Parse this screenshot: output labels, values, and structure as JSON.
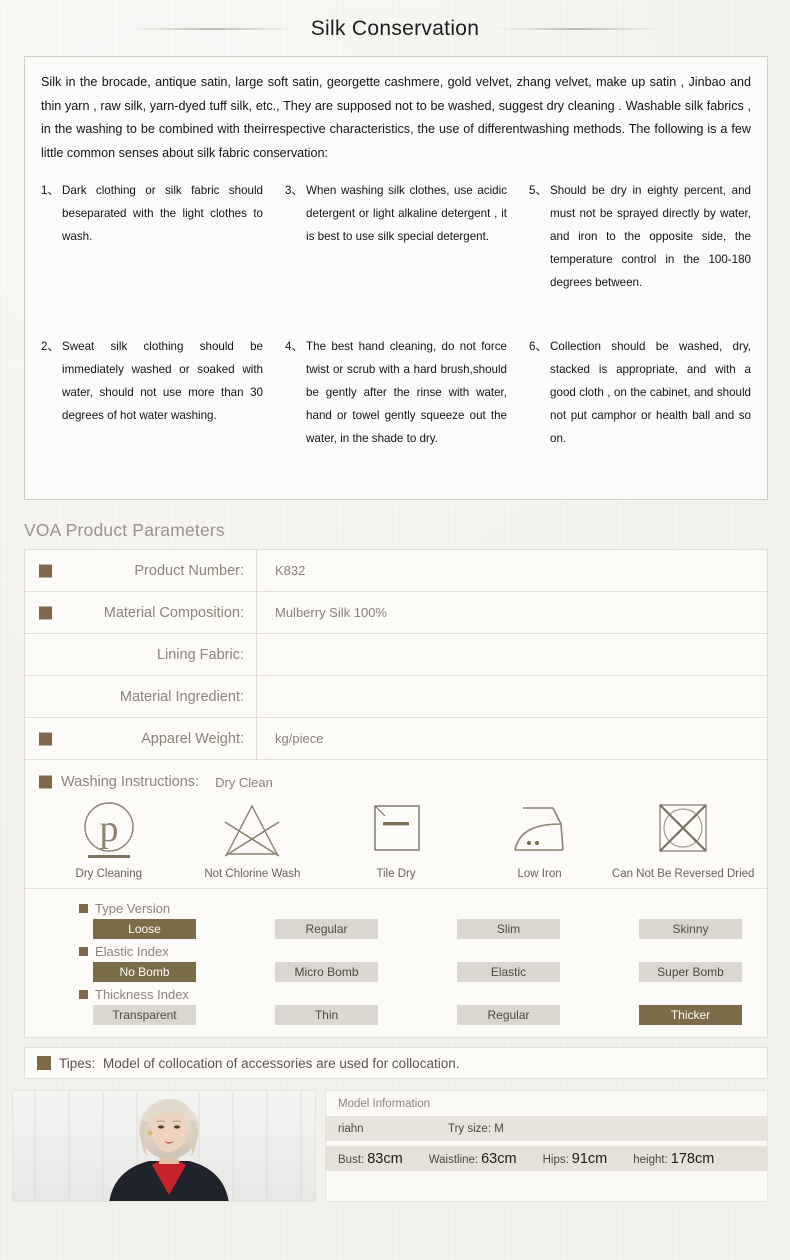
{
  "header": {
    "title": "Silk Conservation"
  },
  "conservation": {
    "intro": "Silk in the brocade, antique satin, large soft satin, georgette cashmere, gold velvet, zhang velvet, make up satin , Jinbao and thin yarn , raw silk, yarn-dyed tuff silk, etc., They are supposed not to be washed, suggest dry cleaning . Washable silk fabrics , in the washing to be combined with theirrespective characteristics, the use of differentwashing methods. The following is a few little common senses about silk fabric conservation:",
    "notes": [
      {
        "num": "1、",
        "text": "Dark clothing or silk fabric should beseparated with the light clothes to wash."
      },
      {
        "num": "3、",
        "text": "When washing silk clothes, use acidic detergent or light alkaline detergent , it is best to use silk special detergent."
      },
      {
        "num": "5、",
        "text": "Should be dry in eighty percent, and must not be sprayed directly by water, and iron to the opposite side, the temperature control in the 100-180 degrees between."
      },
      {
        "num": "2、",
        "text": "Sweat silk clothing should be immediately washed or soaked with water, should not use more than 30 degrees of hot water washing."
      },
      {
        "num": "4、",
        "text": "The best hand cleaning, do not force twist or scrub with a hard brush,should be gently after the rinse with water, hand or towel gently squeeze out the water, in the shade to dry."
      },
      {
        "num": "6、",
        "text": "Collection should be washed, dry, stacked is appropriate, and with a good cloth , on the cabinet, and should not put camphor or health ball and so on."
      }
    ]
  },
  "parameters": {
    "heading": "VOA Product Parameters",
    "rows": [
      {
        "label": "Product Number:",
        "value": "K832",
        "marker": true
      },
      {
        "label": "Material Composition:",
        "value": "Mulberry Silk 100%",
        "marker": true
      },
      {
        "label": "Lining Fabric:",
        "value": "",
        "marker": false
      },
      {
        "label": "Material Ingredient:",
        "value": "",
        "marker": false
      },
      {
        "label": "Apparel Weight:",
        "value": "kg/piece",
        "marker": true
      }
    ]
  },
  "washing": {
    "label": "Washing Instructions:",
    "value": "Dry Clean",
    "icons": [
      {
        "name": "dry-cleaning-icon",
        "label": "Dry Cleaning"
      },
      {
        "name": "not-chlorine-wash-icon",
        "label": "Not Chlorine Wash"
      },
      {
        "name": "tile-dry-icon",
        "label": "Tile Dry"
      },
      {
        "name": "low-iron-icon",
        "label": "Low Iron"
      },
      {
        "name": "no-tumble-dry-icon",
        "label": "Can Not Be Reversed Dried"
      }
    ]
  },
  "indexes": [
    {
      "label": "Type Version",
      "tags": [
        {
          "text": "Loose",
          "selected": true
        },
        {
          "text": "Regular",
          "selected": false
        },
        {
          "text": "Slim",
          "selected": false
        },
        {
          "text": "Skinny",
          "selected": false
        }
      ]
    },
    {
      "label": "Elastic Index",
      "tags": [
        {
          "text": "No  Bomb",
          "selected": true
        },
        {
          "text": "Micro  Bomb",
          "selected": false
        },
        {
          "text": "Elastic",
          "selected": false
        },
        {
          "text": "Super  Bomb",
          "selected": false
        }
      ]
    },
    {
      "label": "Thickness Index",
      "tags": [
        {
          "text": "Transparent",
          "selected": false
        },
        {
          "text": "Thin",
          "selected": false
        },
        {
          "text": "Regular",
          "selected": false
        },
        {
          "text": "Thicker",
          "selected": true
        }
      ]
    }
  ],
  "tipes": {
    "label": "Tipes:",
    "text": "Model of collocation of accessories are used for collocation."
  },
  "model": {
    "info_title": "Model Information",
    "name": "riahn",
    "try_size": "Try size: M",
    "metrics": [
      {
        "key": "Bust:",
        "value": "83cm"
      },
      {
        "key": "Waistline:",
        "value": "63cm"
      },
      {
        "key": "Hips:",
        "value": "91cm"
      },
      {
        "key": "height:",
        "value": "178cm"
      }
    ]
  },
  "colors": {
    "marker_brown": "#80694a",
    "tag_selected": "#7d6c49",
    "tag_idle": "#d9d7d0",
    "heading_gray": "#9c9288",
    "icon_stroke": "#7e7361",
    "page_bg": "#f2f1ec"
  }
}
